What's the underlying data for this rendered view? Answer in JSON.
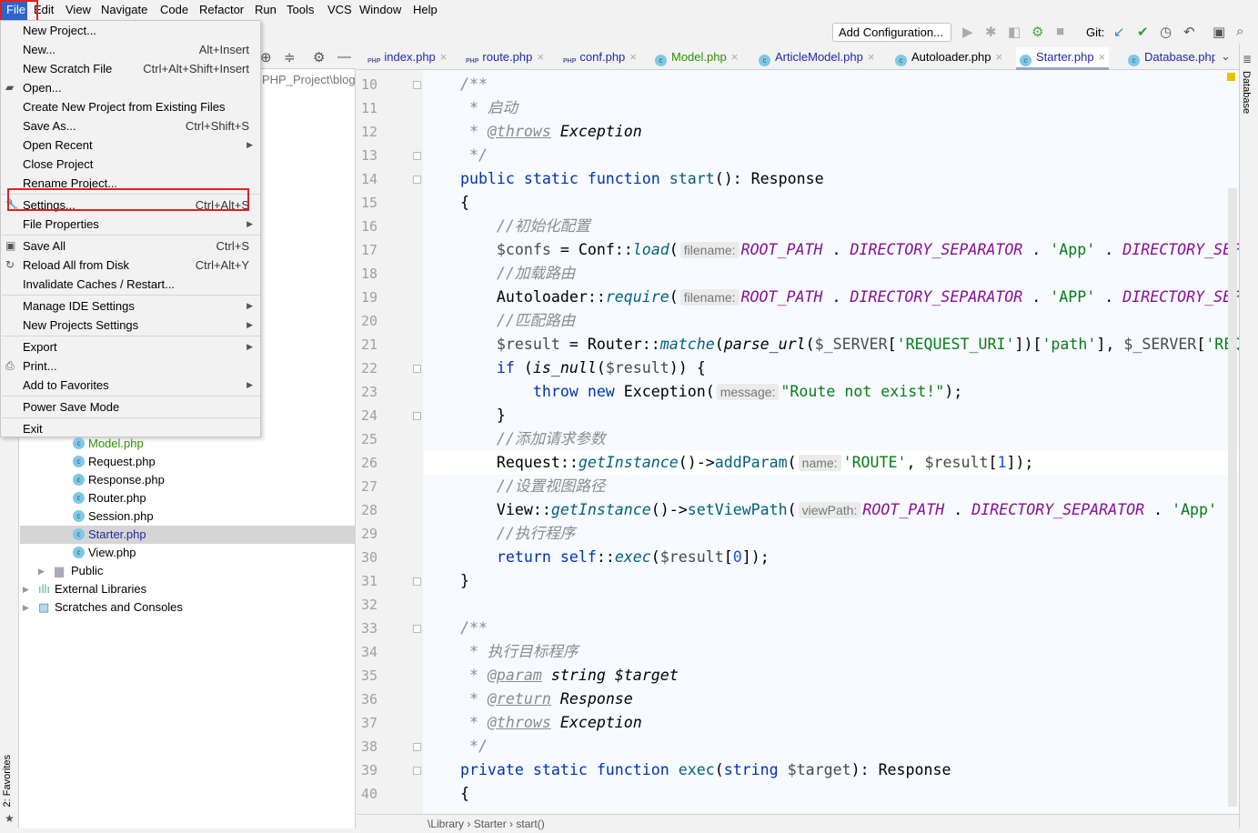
{
  "menubar": [
    "File",
    "Edit",
    "View",
    "Navigate",
    "Code",
    "Refactor",
    "Run",
    "Tools",
    "VCS",
    "Window",
    "Help"
  ],
  "toolbar": {
    "add_configuration": "Add Configuration...",
    "git_label": "Git:"
  },
  "project": {
    "path": "PHP_Project\\blog",
    "tree": [
      {
        "label": "Model.php",
        "color": "#2f8f00"
      },
      {
        "label": "Request.php"
      },
      {
        "label": "Response.php"
      },
      {
        "label": "Router.php"
      },
      {
        "label": "Session.php"
      },
      {
        "label": "Starter.php",
        "selected": true,
        "color": "#1f2aa8"
      },
      {
        "label": "View.php"
      },
      {
        "label": "Public",
        "type": "folder"
      },
      {
        "label": "External Libraries",
        "type": "library"
      },
      {
        "label": "Scratches and Consoles",
        "type": "scratches"
      }
    ]
  },
  "tabs": [
    {
      "label": "index.php",
      "icon": "php"
    },
    {
      "label": "route.php",
      "icon": "php"
    },
    {
      "label": "conf.php",
      "icon": "php"
    },
    {
      "label": "Model.php",
      "icon": "class"
    },
    {
      "label": "ArticleModel.php",
      "icon": "class"
    },
    {
      "label": "Autoloader.php",
      "icon": "class"
    },
    {
      "label": "Starter.php",
      "icon": "class",
      "active": true
    },
    {
      "label": "Database.php",
      "icon": "class"
    }
  ],
  "file_menu": [
    {
      "label": "New Project...",
      "shortcut": ""
    },
    {
      "label": "New...",
      "shortcut": "Alt+Insert"
    },
    {
      "label": "New Scratch File",
      "shortcut": "Ctrl+Alt+Shift+Insert"
    },
    {
      "label": "Open...",
      "icon": "folder"
    },
    {
      "label": "Create New Project from Existing Files"
    },
    {
      "label": "Save As...",
      "shortcut": "Ctrl+Shift+S"
    },
    {
      "label": "Open Recent",
      "submenu": true
    },
    {
      "label": "Close Project"
    },
    {
      "label": "Rename Project..."
    },
    {
      "label": "Settings...",
      "shortcut": "Ctrl+Alt+S",
      "icon": "wrench",
      "highlighted_box": true
    },
    {
      "label": "File Properties",
      "submenu": true
    },
    {
      "label": "Save All",
      "shortcut": "Ctrl+S",
      "icon": "save"
    },
    {
      "label": "Reload All from Disk",
      "shortcut": "Ctrl+Alt+Y",
      "icon": "reload"
    },
    {
      "label": "Invalidate Caches / Restart..."
    },
    {
      "label": "Manage IDE Settings",
      "submenu": true
    },
    {
      "label": "New Projects Settings",
      "submenu": true
    },
    {
      "label": "Export",
      "submenu": true
    },
    {
      "label": "Print...",
      "icon": "print"
    },
    {
      "label": "Add to Favorites",
      "submenu": true
    },
    {
      "label": "Power Save Mode"
    },
    {
      "label": "Exit"
    }
  ],
  "editor": {
    "first_line": 10,
    "current_line": 26,
    "lines": [
      [
        [
          "cm",
          "    /**"
        ]
      ],
      [
        [
          "cm",
          "     * 启动"
        ]
      ],
      [
        [
          "cm",
          "     * "
        ],
        [
          "tg",
          "@throws"
        ],
        [
          "ty",
          " Exception"
        ]
      ],
      [
        [
          "cm",
          "     */"
        ]
      ],
      [
        [
          "kw",
          "    public static function "
        ],
        [
          "fn",
          "start"
        ],
        [
          "",
          "(): Response"
        ]
      ],
      [
        [
          "",
          "    {"
        ]
      ],
      [
        [
          "cm",
          "        //初始化配置"
        ]
      ],
      [
        [
          "va",
          "        $confs"
        ],
        [
          "",
          " = Conf::"
        ],
        [
          "si",
          "load"
        ],
        [
          "",
          "("
        ],
        [
          "hi",
          "filename:"
        ],
        [
          "co",
          "ROOT_PATH"
        ],
        [
          "",
          " . "
        ],
        [
          "co",
          "DIRECTORY_SEPARATOR"
        ],
        [
          "",
          " . "
        ],
        [
          "st",
          "'App'"
        ],
        [
          "",
          " . "
        ],
        [
          "co",
          "DIRECTORY_SEPARATOR"
        ]
      ],
      [
        [
          "cm",
          "        //加载路由"
        ]
      ],
      [
        [
          "",
          "        Autoloader::"
        ],
        [
          "si",
          "require"
        ],
        [
          "",
          "("
        ],
        [
          "hi",
          "filename:"
        ],
        [
          "co",
          "ROOT_PATH"
        ],
        [
          "",
          " . "
        ],
        [
          "co",
          "DIRECTORY_SEPARATOR"
        ],
        [
          "",
          " . "
        ],
        [
          "st",
          "'APP'"
        ],
        [
          "",
          " . "
        ],
        [
          "co",
          "DIRECTORY_SEPARATOR"
        ]
      ],
      [
        [
          "cm",
          "        //匹配路由"
        ]
      ],
      [
        [
          "va",
          "        $result"
        ],
        [
          "",
          " = Router::"
        ],
        [
          "si",
          "matche"
        ],
        [
          "",
          "("
        ],
        [
          "fi",
          "parse_url"
        ],
        [
          "",
          "("
        ],
        [
          "va",
          "$_SERVER"
        ],
        [
          "",
          "["
        ],
        [
          "st",
          "'REQUEST_URI'"
        ],
        [
          "",
          "])["
        ],
        [
          "st",
          "'path'"
        ],
        [
          "",
          "], "
        ],
        [
          "va",
          "$_SERVER"
        ],
        [
          "",
          "["
        ],
        [
          "st",
          "'REQUEST_METHOD'"
        ]
      ],
      [
        [
          "kw",
          "        if"
        ],
        [
          "",
          " ("
        ],
        [
          "fi",
          "is_null"
        ],
        [
          "",
          "("
        ],
        [
          "va",
          "$result"
        ],
        [
          "",
          ")) {"
        ]
      ],
      [
        [
          "kw",
          "            throw new "
        ],
        [
          "",
          "Exception("
        ],
        [
          "hi",
          "message:"
        ],
        [
          "st",
          "\"Route not exist!\""
        ],
        [
          "",
          ");"
        ]
      ],
      [
        [
          "",
          "        }"
        ]
      ],
      [
        [
          "cm",
          "        //添加请求参数"
        ]
      ],
      [
        [
          "",
          "        Request::"
        ],
        [
          "si",
          "getInstance"
        ],
        [
          "",
          "()->"
        ],
        [
          "fn",
          "addParam"
        ],
        [
          "",
          "("
        ],
        [
          "hi",
          "name:"
        ],
        [
          "st",
          "'ROUTE'"
        ],
        [
          "",
          ", "
        ],
        [
          "va",
          "$result"
        ],
        [
          "",
          "["
        ],
        [
          "nu",
          "1"
        ],
        [
          "",
          "]);"
        ]
      ],
      [
        [
          "cm",
          "        //设置视图路径"
        ]
      ],
      [
        [
          "",
          "        View::"
        ],
        [
          "si",
          "getInstance"
        ],
        [
          "",
          "()->"
        ],
        [
          "fn",
          "setViewPath"
        ],
        [
          "",
          "("
        ],
        [
          "hi",
          "viewPath:"
        ],
        [
          "co",
          "ROOT_PATH"
        ],
        [
          "",
          " . "
        ],
        [
          "co",
          "DIRECTORY_SEPARATOR"
        ],
        [
          "",
          " . "
        ],
        [
          "st",
          "'App'"
        ]
      ],
      [
        [
          "cm",
          "        //执行程序"
        ]
      ],
      [
        [
          "kw",
          "        return "
        ],
        [
          "kw",
          "self"
        ],
        [
          "",
          "::"
        ],
        [
          "si",
          "exec"
        ],
        [
          "",
          "("
        ],
        [
          "va",
          "$result"
        ],
        [
          "",
          "["
        ],
        [
          "nu",
          "0"
        ],
        [
          "",
          "]);"
        ]
      ],
      [
        [
          "",
          "    }"
        ]
      ],
      [],
      [
        [
          "cm",
          "    /**"
        ]
      ],
      [
        [
          "cm",
          "     * 执行目标程序"
        ]
      ],
      [
        [
          "cm",
          "     * "
        ],
        [
          "tg",
          "@param"
        ],
        [
          "ty",
          " string $target"
        ]
      ],
      [
        [
          "cm",
          "     * "
        ],
        [
          "tg",
          "@return"
        ],
        [
          "ty",
          " Response"
        ]
      ],
      [
        [
          "cm",
          "     * "
        ],
        [
          "tg",
          "@throws"
        ],
        [
          "ty",
          " Exception"
        ]
      ],
      [
        [
          "cm",
          "     */"
        ]
      ],
      [
        [
          "kw",
          "    private static function "
        ],
        [
          "fn",
          "exec"
        ],
        [
          "",
          "("
        ],
        [
          "kw",
          "string"
        ],
        [
          "",
          " "
        ],
        [
          "va",
          "$target"
        ],
        [
          "",
          "): Response"
        ]
      ],
      [
        [
          "",
          "    {"
        ]
      ]
    ]
  },
  "breadcrumb": [
    "\\Library",
    "Starter",
    "start()"
  ],
  "right_stripe": "Database",
  "left_stripe": "2: Favorites"
}
